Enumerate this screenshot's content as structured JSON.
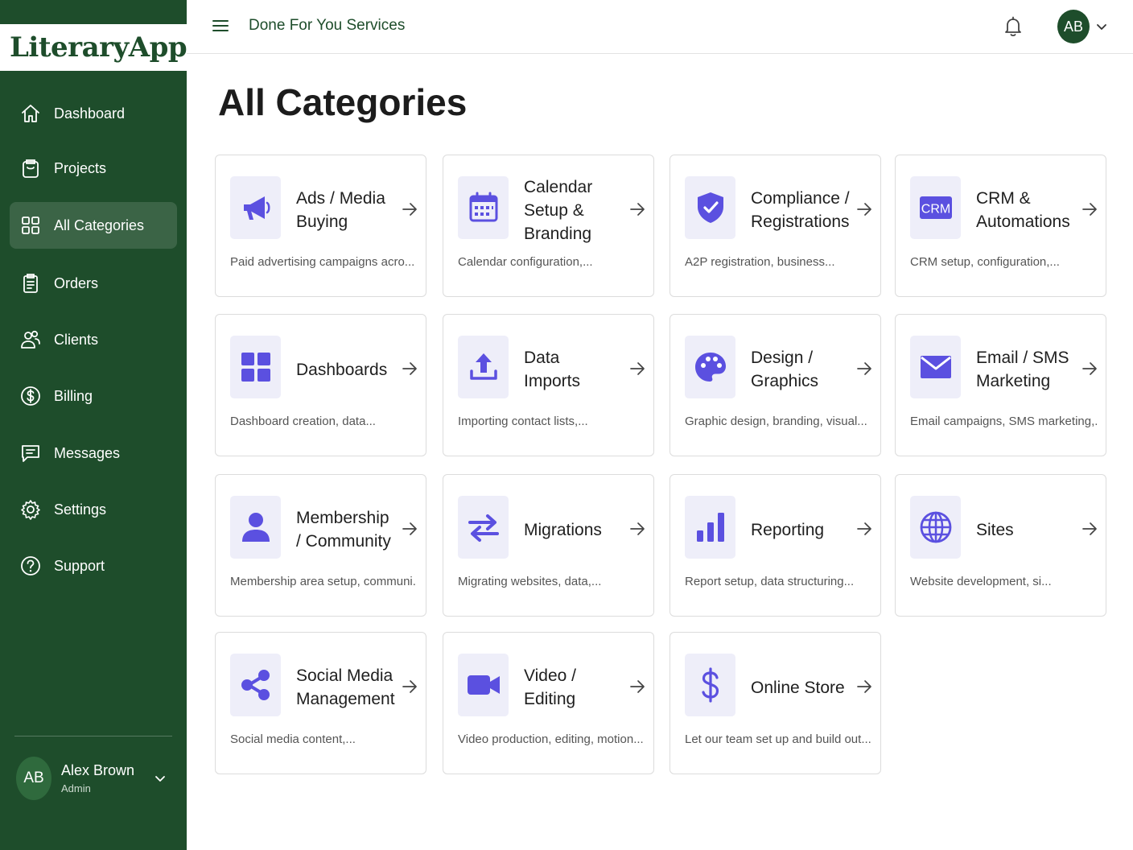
{
  "app": {
    "logo_part1": "LiteraryApp",
    "logo_part2": "",
    "brand_green": "#1e4d2b",
    "brand_orange": "#c27a32",
    "icon_accent": "#5b50e0"
  },
  "topbar": {
    "title": "Done For You Services",
    "avatar_initials": "AB"
  },
  "sidebar": {
    "items": [
      {
        "label": "Dashboard",
        "icon": "home-icon",
        "active": false
      },
      {
        "label": "Projects",
        "icon": "clipboard-icon",
        "active": false
      },
      {
        "label": "All Categories",
        "icon": "grid-icon",
        "active": true
      },
      {
        "label": "Orders",
        "icon": "list-clipboard-icon",
        "active": false
      },
      {
        "label": "Clients",
        "icon": "users-icon",
        "active": false
      },
      {
        "label": "Billing",
        "icon": "dollar-circle-icon",
        "active": false
      },
      {
        "label": "Messages",
        "icon": "message-icon",
        "active": false
      },
      {
        "label": "Settings",
        "icon": "gear-icon",
        "active": false
      },
      {
        "label": "Support",
        "icon": "help-circle-icon",
        "active": false
      }
    ],
    "user": {
      "initials": "AB",
      "name": "Alex Brown",
      "role": "Admin"
    }
  },
  "main": {
    "page_title": "All Categories",
    "categories": [
      {
        "title": "Ads / Media Buying",
        "description": "Paid advertising campaigns acro...",
        "icon": "megaphone-icon"
      },
      {
        "title": "Calendar Setup & Branding",
        "description": "Calendar configuration,...",
        "icon": "calendar-icon"
      },
      {
        "title": "Compliance / Registrations",
        "description": "A2P registration, business...",
        "icon": "shield-check-icon"
      },
      {
        "title": "CRM & Automations",
        "description": "CRM setup, configuration,...",
        "icon": "crm-icon",
        "icon_text": "CRM"
      },
      {
        "title": "Dashboards",
        "description": "Dashboard creation, data...",
        "icon": "dashboard-grid-icon"
      },
      {
        "title": "Data Imports",
        "description": "Importing contact lists,...",
        "icon": "upload-icon"
      },
      {
        "title": "Design / Graphics",
        "description": "Graphic design, branding, visual...",
        "icon": "palette-icon"
      },
      {
        "title": "Email / SMS Marketing",
        "description": "Email campaigns, SMS marketing,...",
        "icon": "envelope-icon"
      },
      {
        "title": "Membership / Community",
        "description": "Membership area setup, communi...",
        "icon": "person-icon"
      },
      {
        "title": "Migrations",
        "description": "Migrating websites, data,...",
        "icon": "swap-arrows-icon"
      },
      {
        "title": "Reporting",
        "description": "Report setup, data structuring...",
        "icon": "bar-chart-icon"
      },
      {
        "title": "Sites",
        "description": "Website development, si...",
        "icon": "globe-icon"
      },
      {
        "title": "Social Media Management",
        "description": "Social media content,...",
        "icon": "share-icon"
      },
      {
        "title": "Video / Editing",
        "description": "Video production, editing, motion...",
        "icon": "video-camera-icon"
      },
      {
        "title": "Online Store",
        "description": "Let our team set up and build out...",
        "icon": "dollar-icon"
      }
    ]
  }
}
